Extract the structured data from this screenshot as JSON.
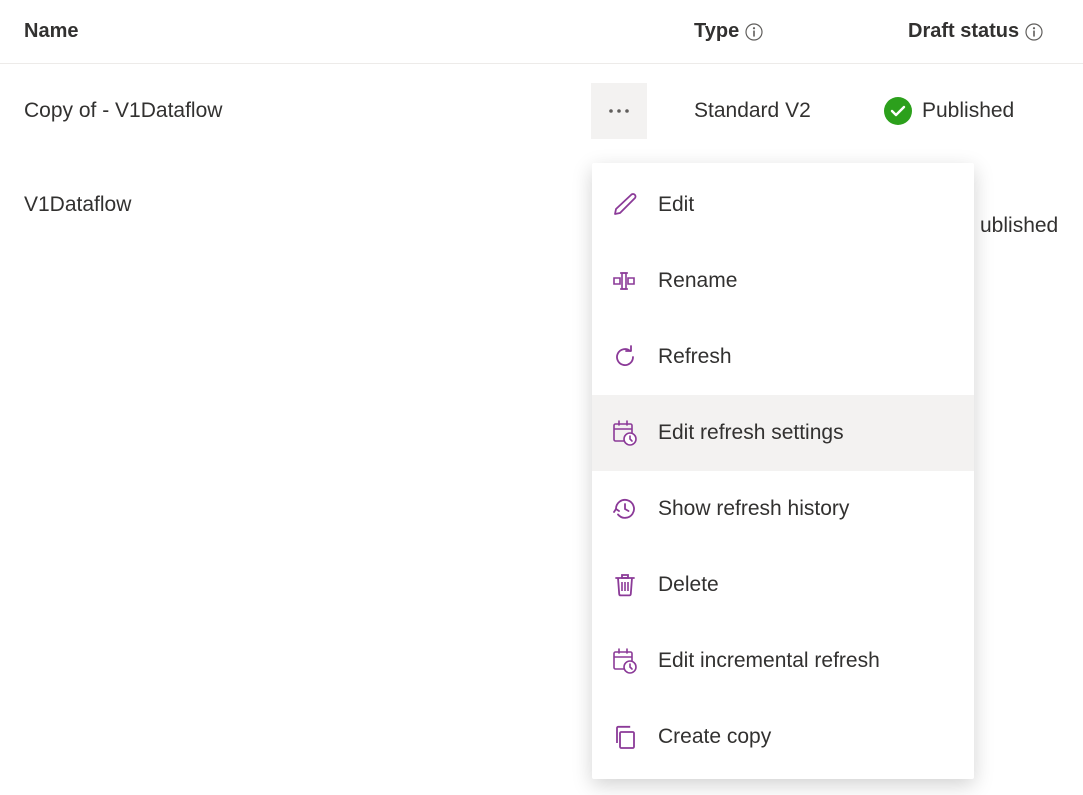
{
  "columns": {
    "name": "Name",
    "type": "Type",
    "draft_status": "Draft status"
  },
  "rows": [
    {
      "name": "Copy of - V1Dataflow",
      "type": "Standard V2",
      "status": "Published"
    },
    {
      "name": "V1Dataflow",
      "type": "",
      "status_partial": "ublished"
    }
  ],
  "menu": {
    "items": [
      {
        "label": "Edit",
        "icon": "pencil-icon"
      },
      {
        "label": "Rename",
        "icon": "rename-icon"
      },
      {
        "label": "Refresh",
        "icon": "refresh-icon"
      },
      {
        "label": "Edit refresh settings",
        "icon": "schedule-icon",
        "hovered": true
      },
      {
        "label": "Show refresh history",
        "icon": "history-icon"
      },
      {
        "label": "Delete",
        "icon": "trash-icon"
      },
      {
        "label": "Edit incremental refresh",
        "icon": "schedule-icon"
      },
      {
        "label": "Create copy",
        "icon": "copy-icon"
      }
    ]
  },
  "colors": {
    "accent": "#8b3a98",
    "success": "#2ca01c"
  }
}
